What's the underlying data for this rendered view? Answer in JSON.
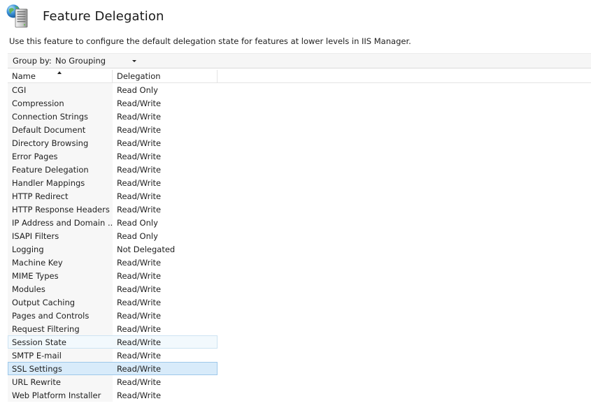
{
  "page": {
    "title": "Feature Delegation",
    "description": "Use this feature to configure the default delegation state for features at lower levels in IIS Manager."
  },
  "group_by": {
    "label": "Group by:",
    "value": "No Grouping"
  },
  "columns": {
    "name": "Name",
    "delegation": "Delegation"
  },
  "rows": [
    {
      "name": "CGI",
      "delegation": "Read Only",
      "state": "normal"
    },
    {
      "name": "Compression",
      "delegation": "Read/Write",
      "state": "normal"
    },
    {
      "name": "Connection Strings",
      "delegation": "Read/Write",
      "state": "normal"
    },
    {
      "name": "Default Document",
      "delegation": "Read/Write",
      "state": "normal"
    },
    {
      "name": "Directory Browsing",
      "delegation": "Read/Write",
      "state": "normal"
    },
    {
      "name": "Error Pages",
      "delegation": "Read/Write",
      "state": "normal"
    },
    {
      "name": "Feature Delegation",
      "delegation": "Read/Write",
      "state": "normal"
    },
    {
      "name": "Handler Mappings",
      "delegation": "Read/Write",
      "state": "normal"
    },
    {
      "name": "HTTP Redirect",
      "delegation": "Read/Write",
      "state": "normal"
    },
    {
      "name": "HTTP Response Headers",
      "delegation": "Read/Write",
      "state": "normal"
    },
    {
      "name": "IP Address and Domain ...",
      "delegation": "Read Only",
      "state": "normal"
    },
    {
      "name": "ISAPI Filters",
      "delegation": "Read Only",
      "state": "normal"
    },
    {
      "name": "Logging",
      "delegation": "Not Delegated",
      "state": "normal"
    },
    {
      "name": "Machine Key",
      "delegation": "Read/Write",
      "state": "normal"
    },
    {
      "name": "MIME Types",
      "delegation": "Read/Write",
      "state": "normal"
    },
    {
      "name": "Modules",
      "delegation": "Read/Write",
      "state": "normal"
    },
    {
      "name": "Output Caching",
      "delegation": "Read/Write",
      "state": "normal"
    },
    {
      "name": "Pages and Controls",
      "delegation": "Read/Write",
      "state": "normal"
    },
    {
      "name": "Request Filtering",
      "delegation": "Read/Write",
      "state": "normal"
    },
    {
      "name": "Session State",
      "delegation": "Read/Write",
      "state": "hover"
    },
    {
      "name": "SMTP E-mail",
      "delegation": "Read/Write",
      "state": "normal"
    },
    {
      "name": "SSL Settings",
      "delegation": "Read/Write",
      "state": "selected"
    },
    {
      "name": "URL Rewrite",
      "delegation": "Read/Write",
      "state": "normal"
    },
    {
      "name": "Web Platform Installer",
      "delegation": "Read/Write",
      "state": "normal"
    }
  ],
  "icons": {
    "header": "globe-server-icon",
    "sort": "sort-ascending-icon",
    "dropdown": "chevron-down-icon"
  },
  "colors": {
    "selected_row": "#cbe4f8",
    "hover_row": "#e8f4fc",
    "name_column_bg": "#f7f7f7"
  }
}
